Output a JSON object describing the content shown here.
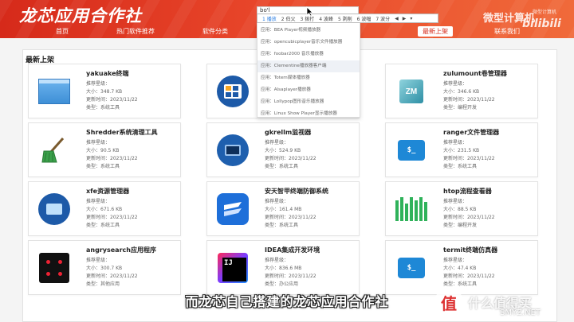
{
  "header": {
    "logo": "龙芯应用合作社",
    "nav": [
      "首页",
      "热门软件推荐",
      "软件分类",
      "最新上架",
      "联系我们"
    ],
    "active_nav": "最新上架",
    "accent": "#d62a1a"
  },
  "watermark": {
    "title": "微型计算机",
    "logo": "bilibili",
    "small": "微型计算机"
  },
  "search": {
    "value": "bo'l",
    "ime_candidates": [
      "1 播放",
      "2 伯父",
      "3 拨打",
      "4 波峰",
      "5 剥削",
      "6 波幅",
      "7 波分"
    ],
    "suggestions": [
      "应用：BEA Player视频播放器",
      "应用：opencubicplayer音乐文件播放器",
      "应用：foobar2000 音乐播放器",
      "应用：Clementine播放器客户端",
      "应用：Totem媒体播放器",
      "应用：Alsaplayer播放器",
      "应用：Lollypop图形音乐播放器",
      "应用：Linux Show Player显示播放器"
    ],
    "highlighted_index": 3
  },
  "main": {
    "section_title": "最新上架",
    "labels": {
      "rating": "推荐星级：",
      "size": "大小：",
      "updated": "更新时间：",
      "category": "类型："
    },
    "cards": [
      {
        "title": "yakuake终端",
        "size": "348.7 KB",
        "updated": "2023/11/22",
        "category": "系统工具",
        "icon": "window-icon"
      },
      {
        "title": "",
        "size": "",
        "updated": "",
        "category": "",
        "icon": "app-icon"
      },
      {
        "title": "zulumount卷管理器",
        "size": "346.6 KB",
        "updated": "2023/11/22",
        "category": "编程开发",
        "icon": "cube-icon"
      },
      {
        "title": "Shredder系统清理工具",
        "size": "90.5 KB",
        "updated": "2023/11/22",
        "category": "系统工具",
        "icon": "broom-icon"
      },
      {
        "title": "gkrellm监视器",
        "size": "524.9 KB",
        "updated": "2023/11/22",
        "category": "系统工具",
        "icon": "monitor-icon"
      },
      {
        "title": "ranger文件管理器",
        "size": "231.5 KB",
        "updated": "2023/11/22",
        "category": "系统工具",
        "icon": "terminal-icon"
      },
      {
        "title": "xfe资源管理器",
        "size": "671.6 KB",
        "updated": "2023/11/22",
        "category": "系统工具",
        "icon": "folder-icon"
      },
      {
        "title": "安天智甲终端防御系统",
        "size": "161.4 MB",
        "updated": "2023/11/22",
        "category": "系统工具",
        "icon": "shield-icon"
      },
      {
        "title": "htop流程查看器",
        "size": "88.5 KB",
        "updated": "2023/11/22",
        "category": "编程开发",
        "icon": "bars-icon"
      },
      {
        "title": "angrysearch应用程序",
        "size": "300.7 KB",
        "updated": "2023/11/22",
        "category": "其他应用",
        "icon": "dots-icon"
      },
      {
        "title": "IDEA集成开发环境",
        "size": "836.6 MB",
        "updated": "2023/11/22",
        "category": "办公应用",
        "icon": "intellij-icon"
      },
      {
        "title": "termit终端仿真器",
        "size": "47.4 KB",
        "updated": "2023/11/22",
        "category": "系统工具",
        "icon": "terminal-icon"
      }
    ]
  },
  "subtitle": "而龙芯自己搭建的龙芯应用合作社",
  "corner_watermark": {
    "glyph": "值",
    "text": "什么值得买",
    "sub": "SMYZ.NET"
  }
}
